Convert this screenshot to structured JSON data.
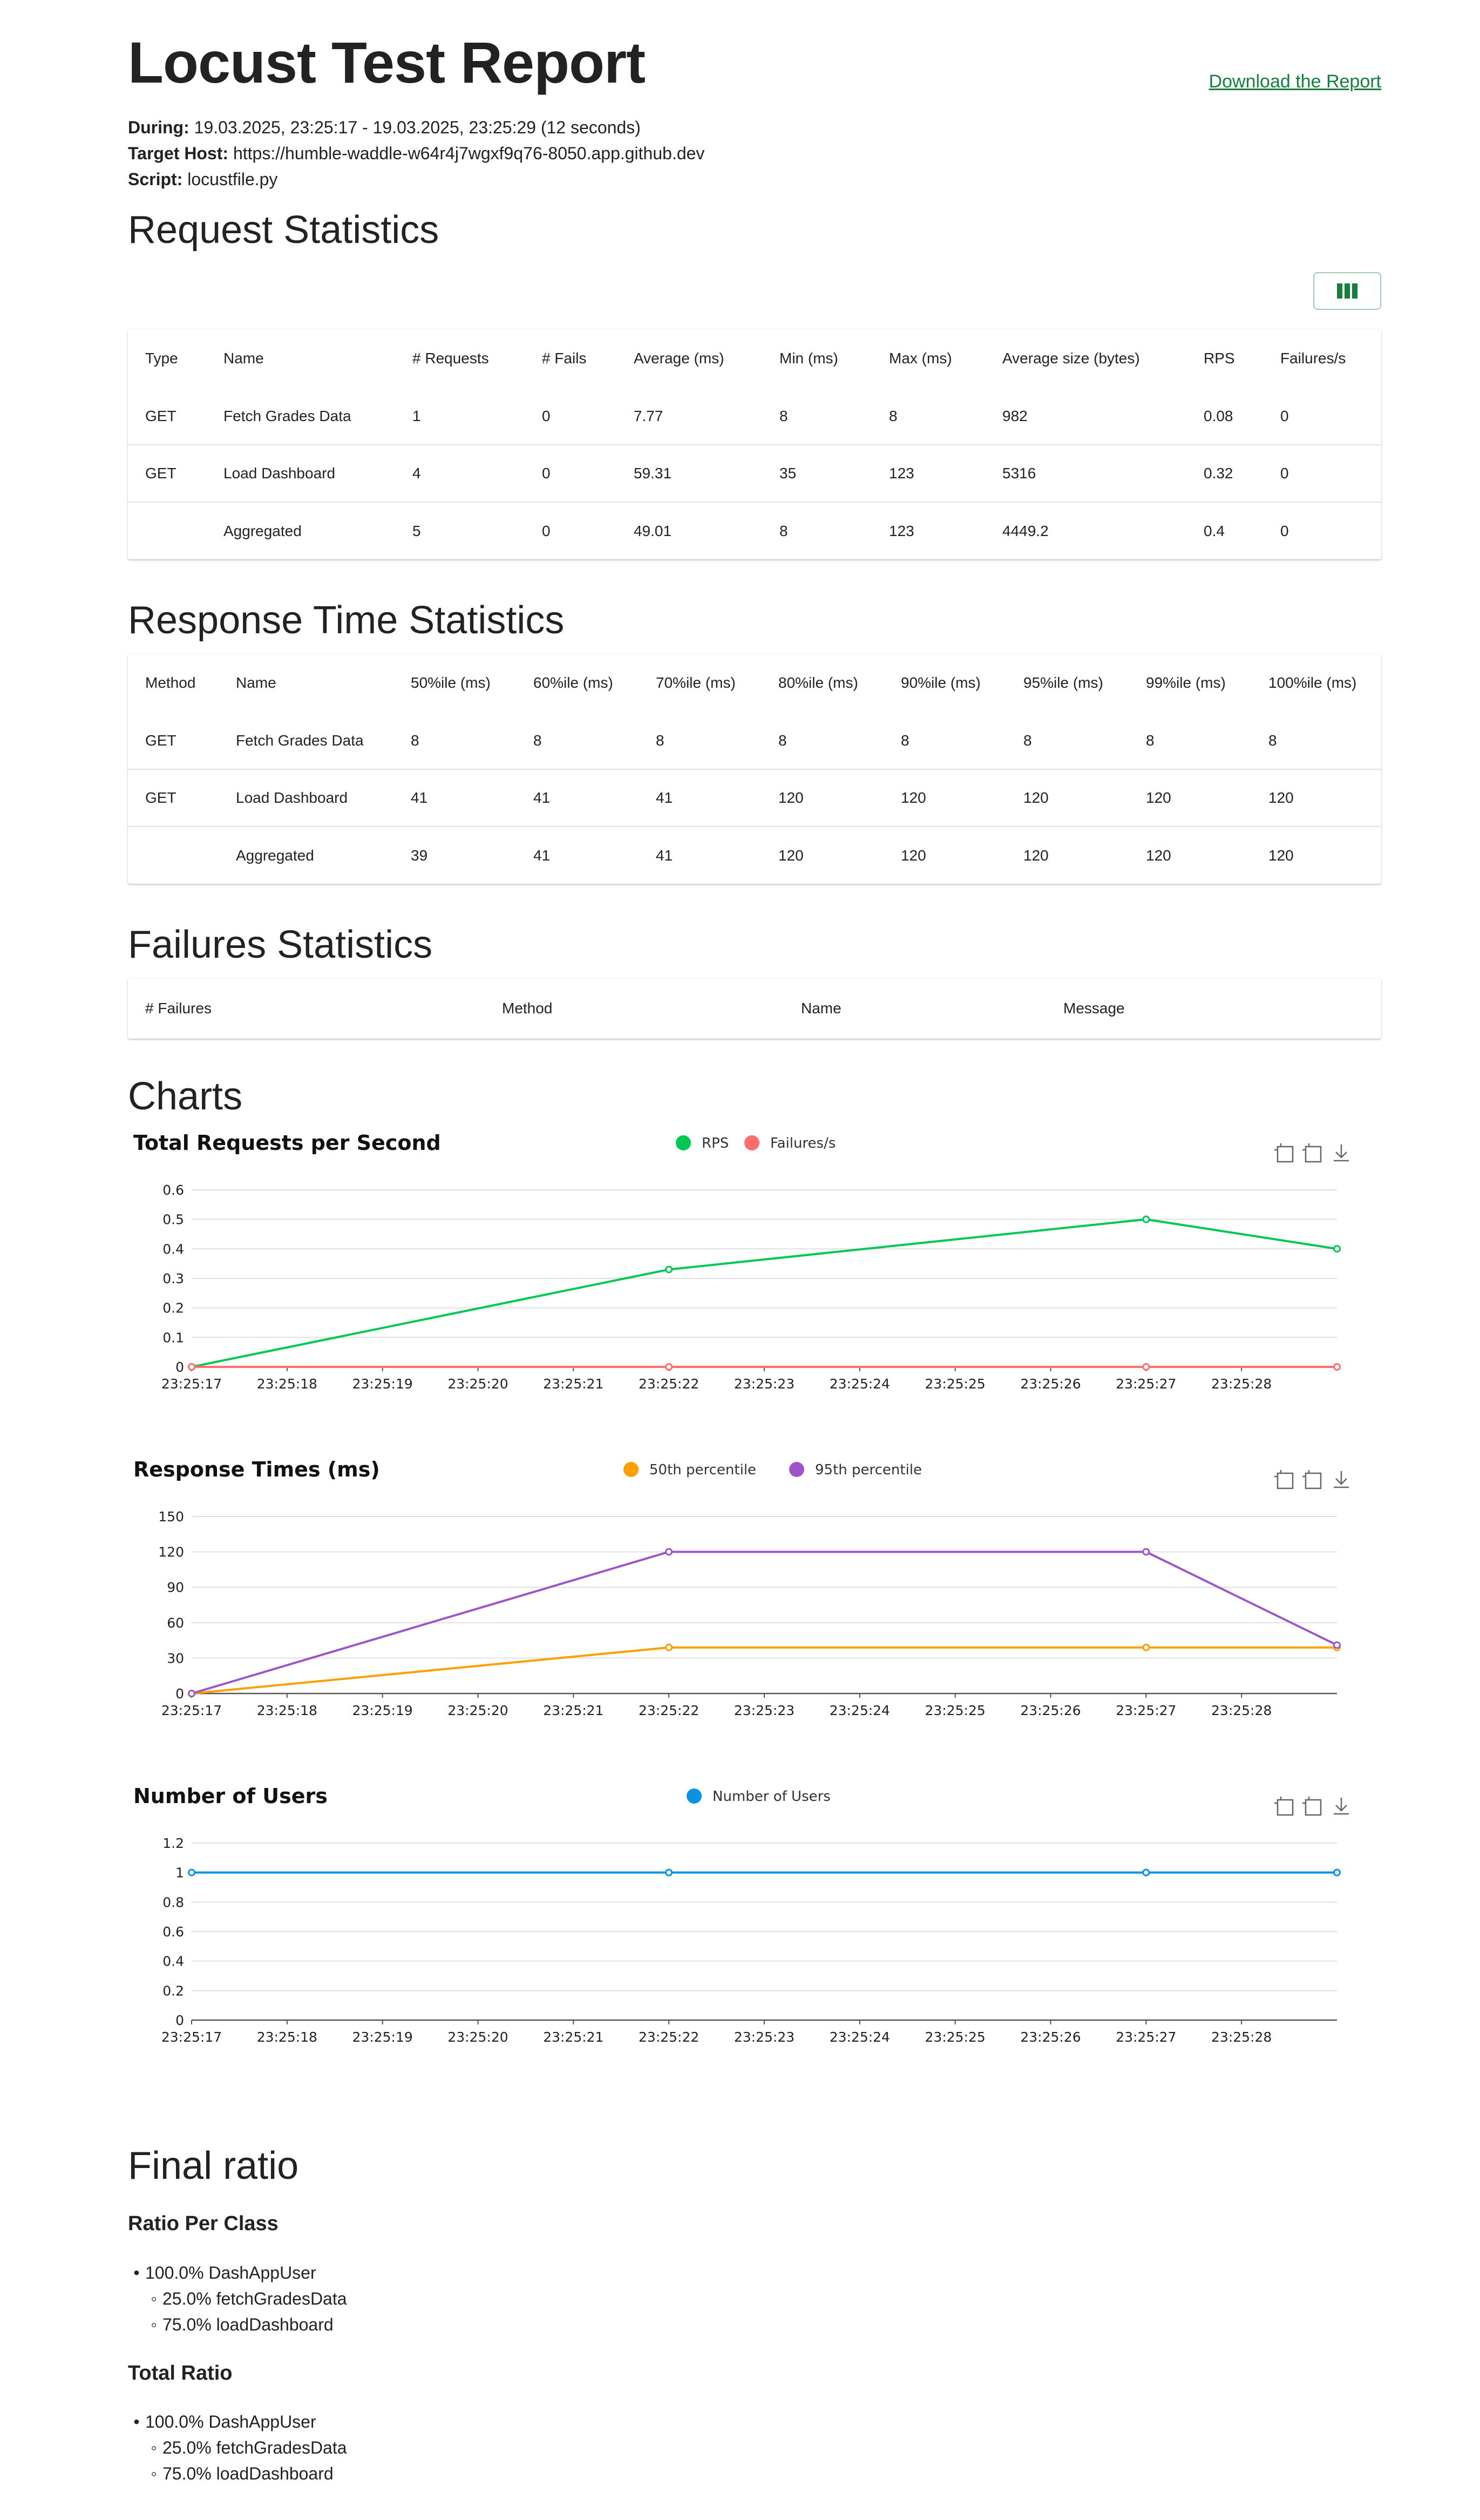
{
  "header": {
    "title": "Locust Test Report",
    "download_label": "Download the Report",
    "during_label": "During:",
    "during_value": "19.03.2025, 23:25:17 - 19.03.2025, 23:25:29 (12 seconds)",
    "host_label": "Target Host:",
    "host_value": "https://humble-waddle-w64r4j7wgxf9q76-8050.app.github.dev",
    "script_label": "Script:",
    "script_value": "locustfile.py"
  },
  "request_stats": {
    "heading": "Request Statistics",
    "columns": [
      "Type",
      "Name",
      "# Requests",
      "# Fails",
      "Average (ms)",
      "Min (ms)",
      "Max (ms)",
      "Average size (bytes)",
      "RPS",
      "Failures/s"
    ],
    "rows": [
      [
        "GET",
        "Fetch Grades Data",
        "1",
        "0",
        "7.77",
        "8",
        "8",
        "982",
        "0.08",
        "0"
      ],
      [
        "GET",
        "Load Dashboard",
        "4",
        "0",
        "59.31",
        "35",
        "123",
        "5316",
        "0.32",
        "0"
      ],
      [
        "",
        "Aggregated",
        "5",
        "0",
        "49.01",
        "8",
        "123",
        "4449.2",
        "0.4",
        "0"
      ]
    ]
  },
  "response_stats": {
    "heading": "Response Time Statistics",
    "columns": [
      "Method",
      "Name",
      "50%ile (ms)",
      "60%ile (ms)",
      "70%ile (ms)",
      "80%ile (ms)",
      "90%ile (ms)",
      "95%ile (ms)",
      "99%ile (ms)",
      "100%ile (ms)"
    ],
    "rows": [
      [
        "GET",
        "Fetch Grades Data",
        "8",
        "8",
        "8",
        "8",
        "8",
        "8",
        "8",
        "8"
      ],
      [
        "GET",
        "Load Dashboard",
        "41",
        "41",
        "41",
        "120",
        "120",
        "120",
        "120",
        "120"
      ],
      [
        "",
        "Aggregated",
        "39",
        "41",
        "41",
        "120",
        "120",
        "120",
        "120",
        "120"
      ]
    ]
  },
  "failure_stats": {
    "heading": "Failures Statistics",
    "columns": [
      "# Failures",
      "Method",
      "Name",
      "Message"
    ]
  },
  "charts_heading": "Charts",
  "colors": {
    "accent": "#15803d",
    "rps": "#00c853",
    "failures": "#ff6d6d",
    "p50": "#ff9f00",
    "p95": "#9c56c9",
    "users": "#0a93e4"
  },
  "chart_data": [
    {
      "type": "line",
      "title": "Total Requests per Second",
      "x": [
        "23:25:17",
        "23:25:22",
        "23:25:27",
        "23:25:29"
      ],
      "tick_labels": [
        "23:25:17",
        "23:25:18",
        "23:25:19",
        "23:25:20",
        "23:25:21",
        "23:25:22",
        "23:25:23",
        "23:25:24",
        "23:25:25",
        "23:25:26",
        "23:25:27",
        "23:25:28"
      ],
      "y_ticks": [
        "0",
        "0.1",
        "0.2",
        "0.3",
        "0.4",
        "0.5",
        "0.6"
      ],
      "ylim": [
        0,
        0.6
      ],
      "series": [
        {
          "name": "RPS",
          "values": [
            0,
            0.33,
            0.5,
            0.4
          ]
        },
        {
          "name": "Failures/s",
          "values": [
            0,
            0,
            0,
            0
          ]
        }
      ],
      "legend": "top"
    },
    {
      "type": "line",
      "title": "Response Times (ms)",
      "x": [
        "23:25:17",
        "23:25:22",
        "23:25:27",
        "23:25:29"
      ],
      "tick_labels": [
        "23:25:17",
        "23:25:18",
        "23:25:19",
        "23:25:20",
        "23:25:21",
        "23:25:22",
        "23:25:23",
        "23:25:24",
        "23:25:25",
        "23:25:26",
        "23:25:27",
        "23:25:28"
      ],
      "y_ticks": [
        "0",
        "30",
        "60",
        "90",
        "120",
        "150"
      ],
      "ylim": [
        0,
        150
      ],
      "series": [
        {
          "name": "50th percentile",
          "values": [
            0,
            39,
            39,
            39
          ]
        },
        {
          "name": "95th percentile",
          "values": [
            0,
            120,
            120,
            41
          ]
        }
      ],
      "legend": "top"
    },
    {
      "type": "line",
      "title": "Number of Users",
      "x": [
        "23:25:17",
        "23:25:22",
        "23:25:27",
        "23:25:29"
      ],
      "tick_labels": [
        "23:25:17",
        "23:25:18",
        "23:25:19",
        "23:25:20",
        "23:25:21",
        "23:25:22",
        "23:25:23",
        "23:25:24",
        "23:25:25",
        "23:25:26",
        "23:25:27",
        "23:25:28"
      ],
      "y_ticks": [
        "0",
        "0.2",
        "0.4",
        "0.6",
        "0.8",
        "1",
        "1.2"
      ],
      "ylim": [
        0,
        1.2
      ],
      "series": [
        {
          "name": "Number of Users",
          "values": [
            1,
            1,
            1,
            1
          ]
        }
      ],
      "legend": "top"
    }
  ],
  "final_ratio": {
    "heading": "Final ratio",
    "per_class": {
      "heading": "Ratio Per Class",
      "user": "100.0% DashAppUser",
      "tasks": [
        "25.0% fetchGradesData",
        "75.0% loadDashboard"
      ]
    },
    "total": {
      "heading": "Total Ratio",
      "user": "100.0% DashAppUser",
      "tasks": [
        "25.0% fetchGradesData",
        "75.0% loadDashboard"
      ]
    }
  }
}
